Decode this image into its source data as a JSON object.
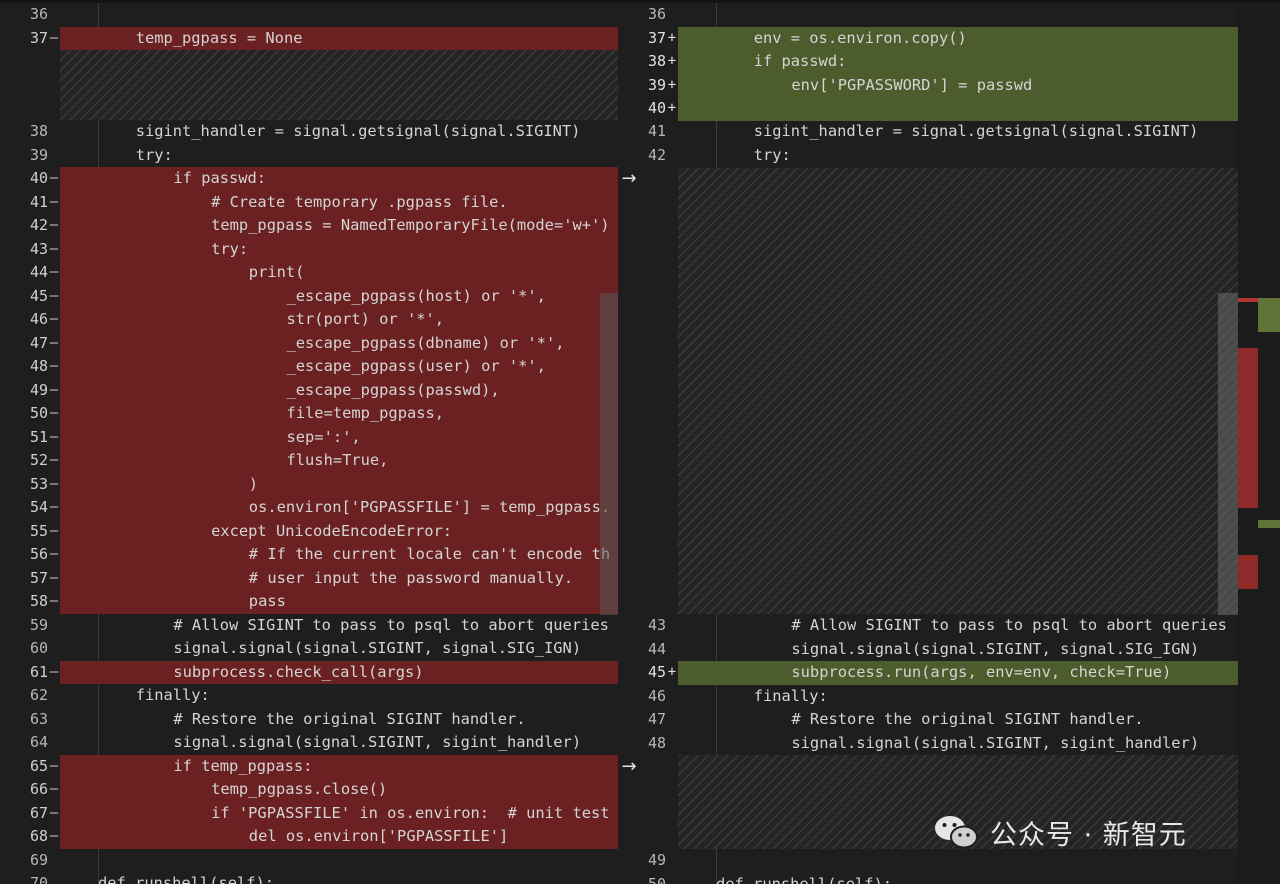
{
  "left_lines": [
    {
      "n": "36",
      "t": ""
    },
    {
      "n": "37",
      "m": "—",
      "t": "temp_pgpass = None",
      "i": 1,
      "d": 1
    },
    {
      "n": "38",
      "t": "sigint_handler = signal.getsignal(signal.SIGINT)",
      "i": 1
    },
    {
      "n": "39",
      "t": "try:",
      "i": 1
    },
    {
      "n": "40",
      "m": "—",
      "t": "if passwd:",
      "i": 2,
      "d": 1
    },
    {
      "n": "41",
      "m": "—",
      "t": "# Create temporary .pgpass file.",
      "i": 3,
      "d": 1
    },
    {
      "n": "42",
      "m": "—",
      "t": "temp_pgpass = NamedTemporaryFile(mode='w+')",
      "i": 3,
      "d": 1
    },
    {
      "n": "43",
      "m": "—",
      "t": "try:",
      "i": 3,
      "d": 1
    },
    {
      "n": "44",
      "m": "—",
      "t": "print(",
      "i": 4,
      "d": 1
    },
    {
      "n": "45",
      "m": "—",
      "t": "_escape_pgpass(host) or '*',",
      "i": 5,
      "d": 1
    },
    {
      "n": "46",
      "m": "—",
      "t": "str(port) or '*',",
      "i": 5,
      "d": 1
    },
    {
      "n": "47",
      "m": "—",
      "t": "_escape_pgpass(dbname) or '*',",
      "i": 5,
      "d": 1
    },
    {
      "n": "48",
      "m": "—",
      "t": "_escape_pgpass(user) or '*',",
      "i": 5,
      "d": 1
    },
    {
      "n": "49",
      "m": "—",
      "t": "_escape_pgpass(passwd),",
      "i": 5,
      "d": 1
    },
    {
      "n": "50",
      "m": "—",
      "t": "file=temp_pgpass,",
      "i": 5,
      "d": 1
    },
    {
      "n": "51",
      "m": "—",
      "t": "sep=':',",
      "i": 5,
      "d": 1
    },
    {
      "n": "52",
      "m": "—",
      "t": "flush=True,",
      "i": 5,
      "d": 1
    },
    {
      "n": "53",
      "m": "—",
      "t": ")",
      "i": 4,
      "d": 1
    },
    {
      "n": "54",
      "m": "—",
      "t": "os.environ['PGPASSFILE'] = temp_pgpass.",
      "i": 4,
      "d": 1
    },
    {
      "n": "55",
      "m": "—",
      "t": "except UnicodeEncodeError:",
      "i": 3,
      "d": 1
    },
    {
      "n": "56",
      "m": "—",
      "t": "# If the current locale can't encode th",
      "i": 4,
      "d": 1
    },
    {
      "n": "57",
      "m": "—",
      "t": "# user input the password manually.",
      "i": 4,
      "d": 1
    },
    {
      "n": "58",
      "m": "—",
      "t": "pass",
      "i": 4,
      "d": 1
    },
    {
      "n": "59",
      "t": "# Allow SIGINT to pass to psql to abort queries",
      "i": 2
    },
    {
      "n": "60",
      "t": "signal.signal(signal.SIGINT, signal.SIG_IGN)",
      "i": 2
    },
    {
      "n": "61",
      "m": "—",
      "t": "subprocess.check_call(args)",
      "i": 2,
      "d": 1
    },
    {
      "n": "62",
      "t": "finally:",
      "i": 1
    },
    {
      "n": "63",
      "t": "# Restore the original SIGINT handler.",
      "i": 2
    },
    {
      "n": "64",
      "t": "signal.signal(signal.SIGINT, sigint_handler)",
      "i": 2
    },
    {
      "n": "65",
      "m": "—",
      "t": "if temp_pgpass:",
      "i": 2,
      "d": 1
    },
    {
      "n": "66",
      "m": "—",
      "t": "temp_pgpass.close()",
      "i": 3,
      "d": 1
    },
    {
      "n": "67",
      "m": "—",
      "t": "if 'PGPASSFILE' in os.environ:  # unit test",
      "i": 3,
      "d": 1
    },
    {
      "n": "68",
      "m": "—",
      "t": "del os.environ['PGPASSFILE']",
      "i": 4,
      "d": 1
    },
    {
      "n": "69",
      "t": ""
    },
    {
      "n": "70",
      "t": "def runshell(self):",
      "i": 0
    }
  ],
  "right_lines": [
    {
      "n": "36",
      "t": ""
    },
    {
      "n": "37",
      "m": "+",
      "t": "env = os.environ.copy()",
      "i": 1,
      "a": 1
    },
    {
      "n": "38",
      "m": "+",
      "t": "if passwd:",
      "i": 1,
      "a": 1
    },
    {
      "n": "39",
      "m": "+",
      "t": "env['PGPASSWORD'] = passwd",
      "i": 2,
      "a": 1
    },
    {
      "n": "40",
      "m": "+",
      "t": "",
      "a": 1
    },
    {
      "n": "41",
      "t": "sigint_handler = signal.getsignal(signal.SIGINT)",
      "i": 1
    },
    {
      "n": "42",
      "t": "try:",
      "i": 1
    },
    {
      "n": "43",
      "t": "# Allow SIGINT to pass to psql to abort queries",
      "i": 2
    },
    {
      "n": "44",
      "t": "signal.signal(signal.SIGINT, signal.SIG_IGN)",
      "i": 2
    },
    {
      "n": "45",
      "m": "+",
      "t": "subprocess.run(args, env=env, check=True)",
      "i": 2,
      "a": 1
    },
    {
      "n": "46",
      "t": "finally:",
      "i": 1
    },
    {
      "n": "47",
      "t": "# Restore the original SIGINT handler.",
      "i": 2
    },
    {
      "n": "48",
      "t": "signal.signal(signal.SIGINT, sigint_handler)",
      "i": 2
    },
    {
      "n": "49",
      "t": ""
    },
    {
      "n": "50",
      "t": "def runshell(self):",
      "i": 0
    }
  ],
  "arrows": [
    "→",
    "→"
  ],
  "watermark": "公众号 · 新智元",
  "colors": {
    "deleted": "#6b2121",
    "added": "#4c5c2c",
    "background": "#1e1e1e"
  }
}
